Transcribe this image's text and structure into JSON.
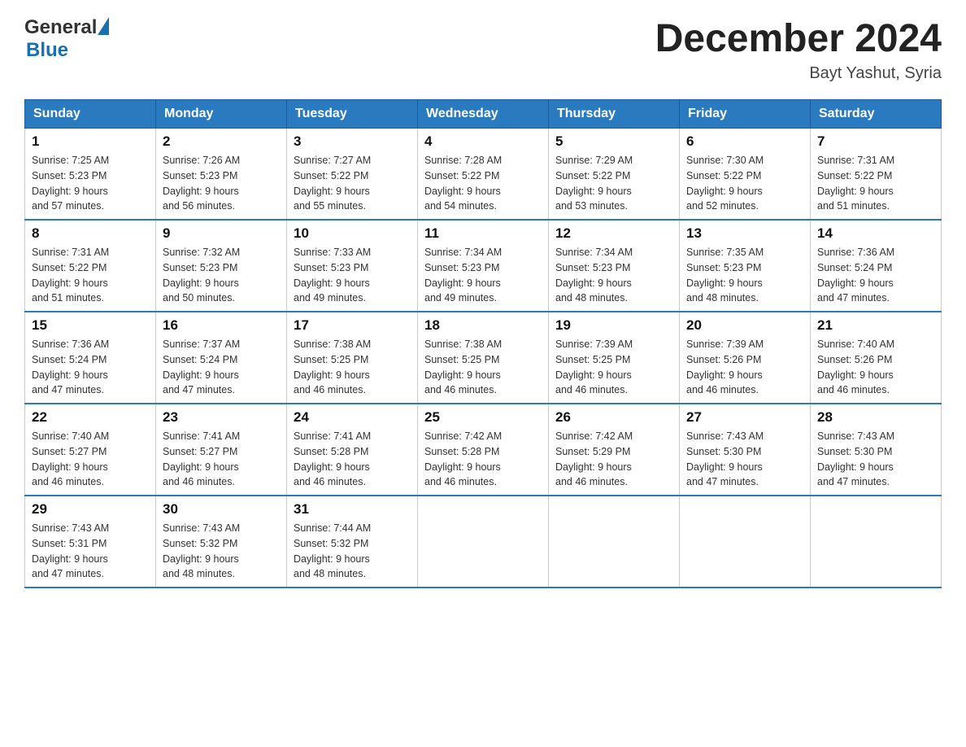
{
  "header": {
    "logo_general": "General",
    "logo_blue": "Blue",
    "title": "December 2024",
    "subtitle": "Bayt Yashut, Syria"
  },
  "days_of_week": [
    "Sunday",
    "Monday",
    "Tuesday",
    "Wednesday",
    "Thursday",
    "Friday",
    "Saturday"
  ],
  "weeks": [
    [
      {
        "day": "1",
        "sunrise": "7:25 AM",
        "sunset": "5:23 PM",
        "daylight": "9 hours and 57 minutes."
      },
      {
        "day": "2",
        "sunrise": "7:26 AM",
        "sunset": "5:23 PM",
        "daylight": "9 hours and 56 minutes."
      },
      {
        "day": "3",
        "sunrise": "7:27 AM",
        "sunset": "5:22 PM",
        "daylight": "9 hours and 55 minutes."
      },
      {
        "day": "4",
        "sunrise": "7:28 AM",
        "sunset": "5:22 PM",
        "daylight": "9 hours and 54 minutes."
      },
      {
        "day": "5",
        "sunrise": "7:29 AM",
        "sunset": "5:22 PM",
        "daylight": "9 hours and 53 minutes."
      },
      {
        "day": "6",
        "sunrise": "7:30 AM",
        "sunset": "5:22 PM",
        "daylight": "9 hours and 52 minutes."
      },
      {
        "day": "7",
        "sunrise": "7:31 AM",
        "sunset": "5:22 PM",
        "daylight": "9 hours and 51 minutes."
      }
    ],
    [
      {
        "day": "8",
        "sunrise": "7:31 AM",
        "sunset": "5:22 PM",
        "daylight": "9 hours and 51 minutes."
      },
      {
        "day": "9",
        "sunrise": "7:32 AM",
        "sunset": "5:23 PM",
        "daylight": "9 hours and 50 minutes."
      },
      {
        "day": "10",
        "sunrise": "7:33 AM",
        "sunset": "5:23 PM",
        "daylight": "9 hours and 49 minutes."
      },
      {
        "day": "11",
        "sunrise": "7:34 AM",
        "sunset": "5:23 PM",
        "daylight": "9 hours and 49 minutes."
      },
      {
        "day": "12",
        "sunrise": "7:34 AM",
        "sunset": "5:23 PM",
        "daylight": "9 hours and 48 minutes."
      },
      {
        "day": "13",
        "sunrise": "7:35 AM",
        "sunset": "5:23 PM",
        "daylight": "9 hours and 48 minutes."
      },
      {
        "day": "14",
        "sunrise": "7:36 AM",
        "sunset": "5:24 PM",
        "daylight": "9 hours and 47 minutes."
      }
    ],
    [
      {
        "day": "15",
        "sunrise": "7:36 AM",
        "sunset": "5:24 PM",
        "daylight": "9 hours and 47 minutes."
      },
      {
        "day": "16",
        "sunrise": "7:37 AM",
        "sunset": "5:24 PM",
        "daylight": "9 hours and 47 minutes."
      },
      {
        "day": "17",
        "sunrise": "7:38 AM",
        "sunset": "5:25 PM",
        "daylight": "9 hours and 46 minutes."
      },
      {
        "day": "18",
        "sunrise": "7:38 AM",
        "sunset": "5:25 PM",
        "daylight": "9 hours and 46 minutes."
      },
      {
        "day": "19",
        "sunrise": "7:39 AM",
        "sunset": "5:25 PM",
        "daylight": "9 hours and 46 minutes."
      },
      {
        "day": "20",
        "sunrise": "7:39 AM",
        "sunset": "5:26 PM",
        "daylight": "9 hours and 46 minutes."
      },
      {
        "day": "21",
        "sunrise": "7:40 AM",
        "sunset": "5:26 PM",
        "daylight": "9 hours and 46 minutes."
      }
    ],
    [
      {
        "day": "22",
        "sunrise": "7:40 AM",
        "sunset": "5:27 PM",
        "daylight": "9 hours and 46 minutes."
      },
      {
        "day": "23",
        "sunrise": "7:41 AM",
        "sunset": "5:27 PM",
        "daylight": "9 hours and 46 minutes."
      },
      {
        "day": "24",
        "sunrise": "7:41 AM",
        "sunset": "5:28 PM",
        "daylight": "9 hours and 46 minutes."
      },
      {
        "day": "25",
        "sunrise": "7:42 AM",
        "sunset": "5:28 PM",
        "daylight": "9 hours and 46 minutes."
      },
      {
        "day": "26",
        "sunrise": "7:42 AM",
        "sunset": "5:29 PM",
        "daylight": "9 hours and 46 minutes."
      },
      {
        "day": "27",
        "sunrise": "7:43 AM",
        "sunset": "5:30 PM",
        "daylight": "9 hours and 47 minutes."
      },
      {
        "day": "28",
        "sunrise": "7:43 AM",
        "sunset": "5:30 PM",
        "daylight": "9 hours and 47 minutes."
      }
    ],
    [
      {
        "day": "29",
        "sunrise": "7:43 AM",
        "sunset": "5:31 PM",
        "daylight": "9 hours and 47 minutes."
      },
      {
        "day": "30",
        "sunrise": "7:43 AM",
        "sunset": "5:32 PM",
        "daylight": "9 hours and 48 minutes."
      },
      {
        "day": "31",
        "sunrise": "7:44 AM",
        "sunset": "5:32 PM",
        "daylight": "9 hours and 48 minutes."
      },
      null,
      null,
      null,
      null
    ]
  ],
  "labels": {
    "sunrise": "Sunrise:",
    "sunset": "Sunset:",
    "daylight": "Daylight:"
  }
}
